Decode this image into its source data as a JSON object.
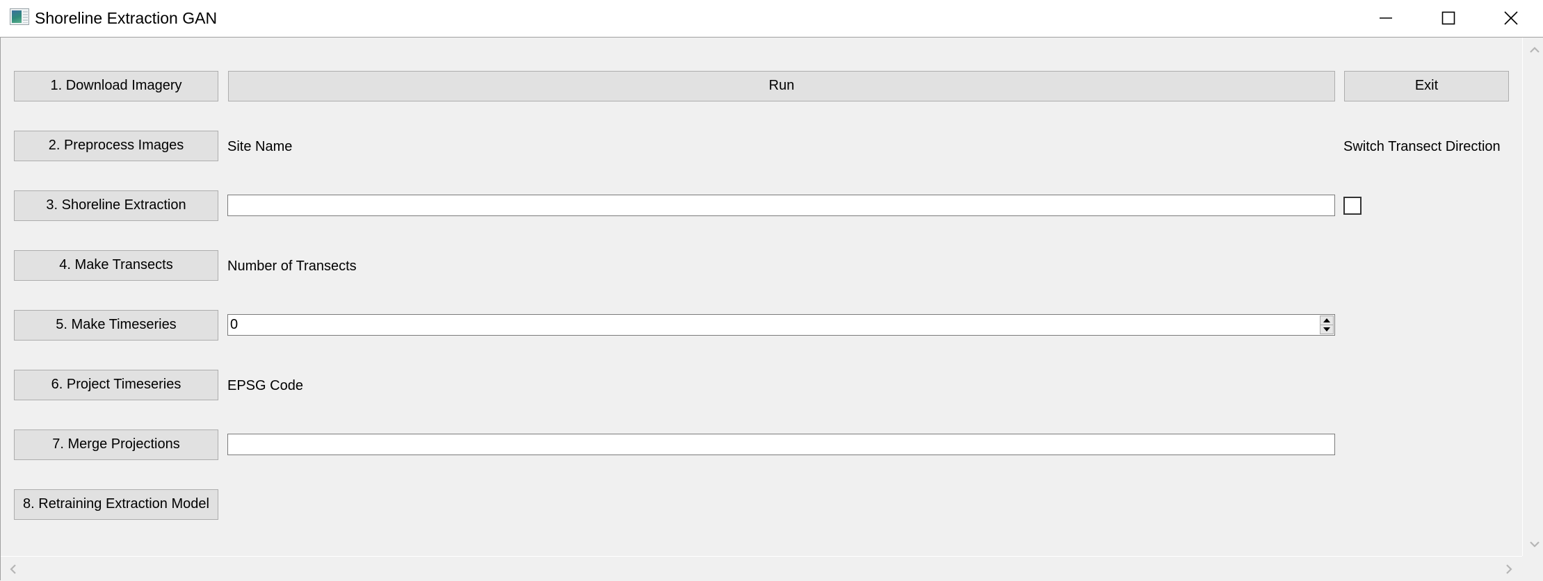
{
  "window": {
    "title": "Shoreline Extraction GAN",
    "icon": "app-window-icon",
    "controls": {
      "minimize": "minimize-icon",
      "maximize": "maximize-icon",
      "close": "close-icon"
    }
  },
  "steps": [
    {
      "label": "1. Download Imagery"
    },
    {
      "label": "2. Preprocess Images"
    },
    {
      "label": "3. Shoreline Extraction"
    },
    {
      "label": "4. Make Transects"
    },
    {
      "label": "5. Make Timeseries"
    },
    {
      "label": "6. Project Timeseries"
    },
    {
      "label": "7. Merge Projections"
    },
    {
      "label": "8. Retraining Extraction Model"
    }
  ],
  "toolbar": {
    "run_label": "Run",
    "exit_label": "Exit"
  },
  "fields": {
    "site_name": {
      "label": "Site Name",
      "value": ""
    },
    "num_transects": {
      "label": "Number of Transects",
      "value": "0"
    },
    "epsg_code": {
      "label": "EPSG Code",
      "value": ""
    },
    "switch_transect": {
      "label": "Switch Transect Direction",
      "checked": false
    }
  },
  "scrollbars": {
    "vertical": {
      "up": "chevron-up-icon",
      "down": "chevron-down-icon"
    },
    "horizontal": {
      "left": "chevron-left-icon",
      "right": "chevron-right-icon"
    }
  }
}
